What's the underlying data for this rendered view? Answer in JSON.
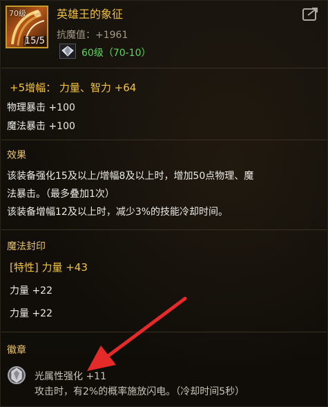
{
  "header": {
    "icon_level": "70级",
    "icon_stack": "15/5",
    "title": "英雄王的象征",
    "resist": "抗魔值：+1961",
    "level_range": "60级（70-10）"
  },
  "amplify": {
    "line": "+5增幅： 力量、智力 +64",
    "stats": [
      "物理暴击 +100",
      "魔法暴击 +100"
    ]
  },
  "effect": {
    "heading": "效果",
    "lines": [
      "该装备强化15及以上/增幅8及以上时，增加50点物理、魔",
      "法暴击。（最多叠加1次）",
      "该装备增幅12及以上时，减少3%的技能冷却时间。"
    ]
  },
  "seal": {
    "heading": "魔法封印",
    "special": "[特性] 力量 +43",
    "lines": [
      "力量 +22",
      "力量 +22"
    ]
  },
  "emblem": {
    "heading": "徽章",
    "name": "光属性强化",
    "value": "+11",
    "desc": "攻击时，有2%的概率施放闪电。（冷却时间5秒）"
  },
  "colors": {
    "title_gold": "#f0c040",
    "level_green": "#5cd85a",
    "arrow_red": "#e52a2a"
  },
  "icons": [
    "item-icon",
    "diamond-icon",
    "share-icon",
    "gem-icon",
    "arrow-annotation"
  ]
}
